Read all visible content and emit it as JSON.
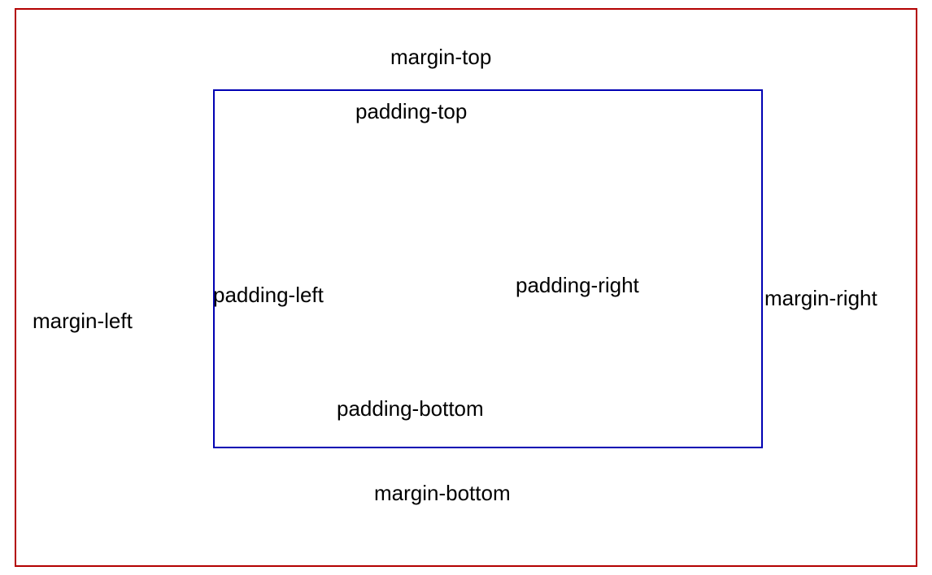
{
  "labels": {
    "margin_top": "margin-top",
    "margin_bottom": "margin-bottom",
    "margin_left": "margin-left",
    "margin_right": "margin-right",
    "padding_top": "padding-top",
    "padding_bottom": "padding-bottom",
    "padding_left": "padding-left",
    "padding_right": "padding-right"
  },
  "colors": {
    "outer_border": "#b30000",
    "inner_border": "#0000b3",
    "text_color": "#000000",
    "background": "#ffffff"
  }
}
